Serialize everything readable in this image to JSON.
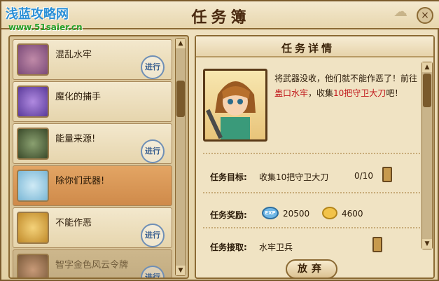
{
  "header": {
    "title": "任务簿",
    "close_icon": "×",
    "logo": "浅蓝攻略网",
    "logo_url": "www.51saier.cn"
  },
  "task_list": [
    {
      "name": "混乱水牢",
      "status": "进行",
      "icon": "monster-icon",
      "state": "normal"
    },
    {
      "name": "魔化的捕手",
      "status": "",
      "icon": "monster-icon",
      "state": "normal"
    },
    {
      "name": "能量来源!",
      "status": "进行",
      "icon": "cauldron-icon",
      "state": "normal"
    },
    {
      "name": "除你们武器!",
      "status": "",
      "icon": "sword-icon",
      "state": "selected"
    },
    {
      "name": "不能作恶",
      "status": "进行",
      "icon": "bell-icon",
      "state": "normal"
    },
    {
      "name": "智字金色风云令牌",
      "status": "进行",
      "icon": "key-icon",
      "state": "disabled"
    }
  ],
  "detail": {
    "title": "任务详情",
    "description_parts": [
      {
        "text": "将武器没收，他们就不能作恶了！前往",
        "red": false
      },
      {
        "text": "蛊口水牢",
        "red": true
      },
      {
        "text": "，收集",
        "red": false
      },
      {
        "text": "10把守卫大刀",
        "red": true
      },
      {
        "text": "吧！",
        "red": false
      }
    ],
    "goal_label": "任务目标:",
    "goal_value": "收集10把守卫大刀",
    "goal_progress": "0/10",
    "reward_label": "任务奖励:",
    "reward_exp_icon": "EXP",
    "reward_exp": "20500",
    "reward_gold": "4600",
    "giver_label": "任务接取:",
    "giver_value": "水牢卫兵",
    "abandon_label": "放弃"
  },
  "scroll": {
    "up": "▲",
    "down": "▼"
  }
}
